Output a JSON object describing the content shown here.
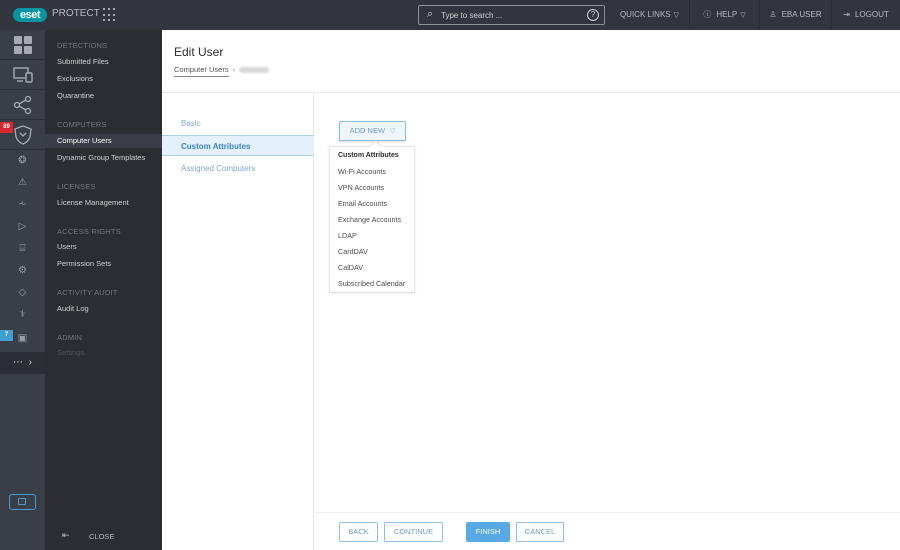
{
  "header": {
    "logo": "eset",
    "product": "PROTECT",
    "search_placeholder": "Type to search ...",
    "quick_links": "QUICK LINKS",
    "help": "HELP",
    "user": "EBA USER",
    "logout": "LOGOUT"
  },
  "rail": {
    "badges": {
      "detections": "89",
      "notifications": "7"
    },
    "icons": [
      "dashboard-icon",
      "computers-icon",
      "network-icon",
      "detections-icon",
      "status-icon",
      "alert-icon",
      "reports-icon",
      "tasks-icon",
      "installers-icon",
      "policies-icon",
      "notifications-icon",
      "status-overview-icon",
      "more-icon"
    ]
  },
  "menu": {
    "sections": [
      {
        "heading": "DETECTIONS",
        "items": [
          "Submitted Files",
          "Exclusions",
          "Quarantine"
        ]
      },
      {
        "heading": "COMPUTERS",
        "items": [
          "Computer Users",
          "Dynamic Group Templates"
        ]
      },
      {
        "heading": "LICENSES",
        "items": [
          "License Management"
        ]
      },
      {
        "heading": "ACCESS RIGHTS",
        "items": [
          "Users",
          "Permission Sets"
        ]
      },
      {
        "heading": "ACTIVITY AUDIT",
        "items": [
          "Audit Log"
        ]
      },
      {
        "heading": "ADMIN",
        "items": [
          "Settings"
        ]
      }
    ],
    "active_item": "Computer Users",
    "close": "CLOSE"
  },
  "page": {
    "title": "Edit User",
    "breadcrumb": [
      "Computer Users"
    ],
    "steps": [
      "Basic",
      "Custom Attributes",
      "Assigned Computers"
    ],
    "active_step": "Custom Attributes"
  },
  "add_new": {
    "label": "ADD NEW",
    "options": [
      "Custom Attributes",
      "Wi-Fi Accounts",
      "VPN Accounts",
      "Email Accounts",
      "Exchange Accounts",
      "LDAP",
      "CardDAV",
      "CalDAV",
      "Subscribed Calendar"
    ]
  },
  "footer": {
    "back": "BACK",
    "continue": "CONTINUE",
    "finish": "FINISH",
    "cancel": "CANCEL"
  },
  "colors": {
    "accent": "#58a8e3",
    "brand": "#0096a1",
    "badge_red": "#d7282f",
    "badge_blue": "#3ea0d3"
  }
}
